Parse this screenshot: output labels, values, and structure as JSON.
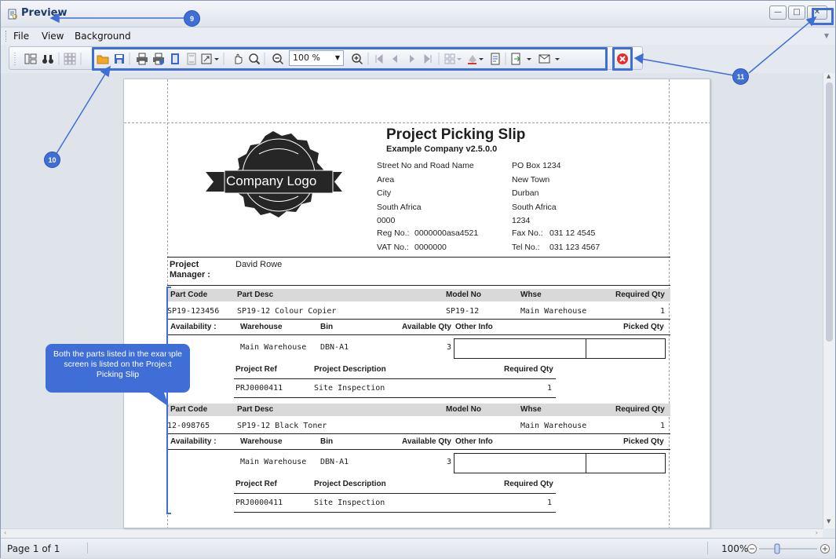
{
  "window": {
    "title": "Preview"
  },
  "menu": {
    "items": [
      "File",
      "View",
      "Background"
    ]
  },
  "toolbar": {
    "zoom_value": "100 %"
  },
  "report": {
    "title": "Project Picking Slip",
    "company": "Example Company v2.5.0.0",
    "logo_text": "Company Logo",
    "address_left": [
      "Street No and Road Name",
      "Area",
      "City",
      "South Africa",
      "0000"
    ],
    "address_right": [
      "PO Box 1234",
      "New Town",
      "Durban",
      "South Africa",
      "1234"
    ],
    "reg_label": "Reg No.:",
    "reg_value": "0000000asa4521",
    "vat_label": "VAT No.:",
    "vat_value": "0000000",
    "fax_label": "Fax No.:",
    "fax_value": "031 12 4545",
    "tel_label": "Tel No.:",
    "tel_value": "031 123 4567",
    "pm_label_1": "Project",
    "pm_label_2": "Manager :",
    "pm_value": "David Rowe",
    "headers": {
      "part_code": "Part Code",
      "part_desc": "Part Desc",
      "model_no": "Model No",
      "whse": "Whse",
      "required_qty": "Required Qty",
      "availability": "Availability :",
      "warehouse": "Warehouse",
      "bin": "Bin",
      "available_qty": "Available Qty",
      "other_info": "Other Info",
      "picked_qty": "Picked Qty",
      "project_ref": "Project Ref",
      "project_description": "Project Description",
      "proj_required_qty": "Required Qty"
    },
    "parts": [
      {
        "part_code": "SP19-123456",
        "part_desc": "SP19-12 Colour Copier",
        "model_no": "SP19-12",
        "whse": "Main Warehouse",
        "required_qty": "1",
        "warehouse": "Main Warehouse",
        "bin": "DBN-A1",
        "available_qty": "3",
        "project_ref": "PRJ0000411",
        "project_description": "Site Inspection",
        "proj_required_qty": "1"
      },
      {
        "part_code": "12-098765",
        "part_desc": "SP19-12 Black Toner",
        "model_no": "",
        "whse": "Main Warehouse",
        "required_qty": "1",
        "warehouse": "Main Warehouse",
        "bin": "DBN-A1",
        "available_qty": "3",
        "project_ref": "PRJ0000411",
        "project_description": "Site Inspection",
        "proj_required_qty": "1"
      }
    ]
  },
  "callout": {
    "text": "Both the parts listed in the example screen is listed on the Project Picking Slip"
  },
  "badges": {
    "b9": "9",
    "b10": "10",
    "b11": "11"
  },
  "status": {
    "page": "Page 1 of 1",
    "zoom": "100%"
  },
  "colors": {
    "accent": "#3f6fd6",
    "cancel": "#e03030"
  }
}
